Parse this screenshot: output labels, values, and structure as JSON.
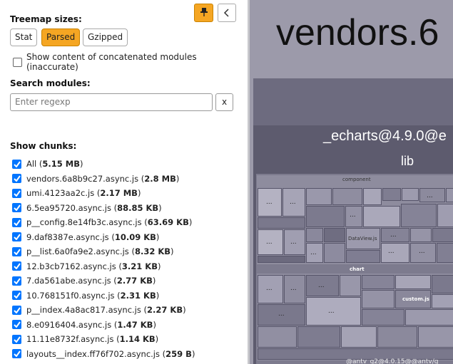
{
  "sidebar": {
    "pin_icon": "pushpin-icon",
    "collapse_icon": "chevron-left-icon",
    "treemap_sizes_title": "Treemap sizes:",
    "size_buttons": [
      {
        "label": "Stat",
        "active": false
      },
      {
        "label": "Parsed",
        "active": true
      },
      {
        "label": "Gzipped",
        "active": false
      }
    ],
    "concat_label": "Show content of concatenated modules (inaccurate)",
    "search_title": "Search modules:",
    "search_placeholder": "Enter regexp",
    "clear_label": "x",
    "chunks_title": "Show chunks:",
    "chunks": [
      {
        "name": "All",
        "size": "5.15 MB"
      },
      {
        "name": "vendors.6a8b9c27.async.js",
        "size": "2.8 MB"
      },
      {
        "name": "umi.4123aa2c.js",
        "size": "2.17 MB"
      },
      {
        "name": "6.5ea95720.async.js",
        "size": "88.85 KB"
      },
      {
        "name": "p__config.8e14fb3c.async.js",
        "size": "63.69 KB"
      },
      {
        "name": "9.daf8387e.async.js",
        "size": "10.09 KB"
      },
      {
        "name": "p__list.6a0fa9e2.async.js",
        "size": "8.32 KB"
      },
      {
        "name": "12.b3cb7162.async.js",
        "size": "3.21 KB"
      },
      {
        "name": "7.da561abe.async.js",
        "size": "2.77 KB"
      },
      {
        "name": "10.768151f0.async.js",
        "size": "2.31 KB"
      },
      {
        "name": "p__index.4a8ac817.async.js",
        "size": "2.27 KB"
      },
      {
        "name": "8.e0916404.async.js",
        "size": "1.47 KB"
      },
      {
        "name": "11.11e8732f.async.js",
        "size": "1.14 KB"
      },
      {
        "name": "layouts__index.ff76f702.async.js",
        "size": "259 B"
      }
    ]
  },
  "treemap": {
    "vendor_title": "vendors.6",
    "echarts_label": "_echarts@4.9.0@e",
    "lib_label": "lib",
    "component_label": "component",
    "dataview_label": "DataView.js",
    "chart_label": "chart",
    "custom_label": "custom.js",
    "bottom_label": "@antv_g2@4.0.15@@antv/g",
    "ellipsis": "..."
  },
  "colors": {
    "accent": "#f5a623",
    "checkbox": "#0075ff",
    "treemap_bg": "#9c9aaa"
  }
}
